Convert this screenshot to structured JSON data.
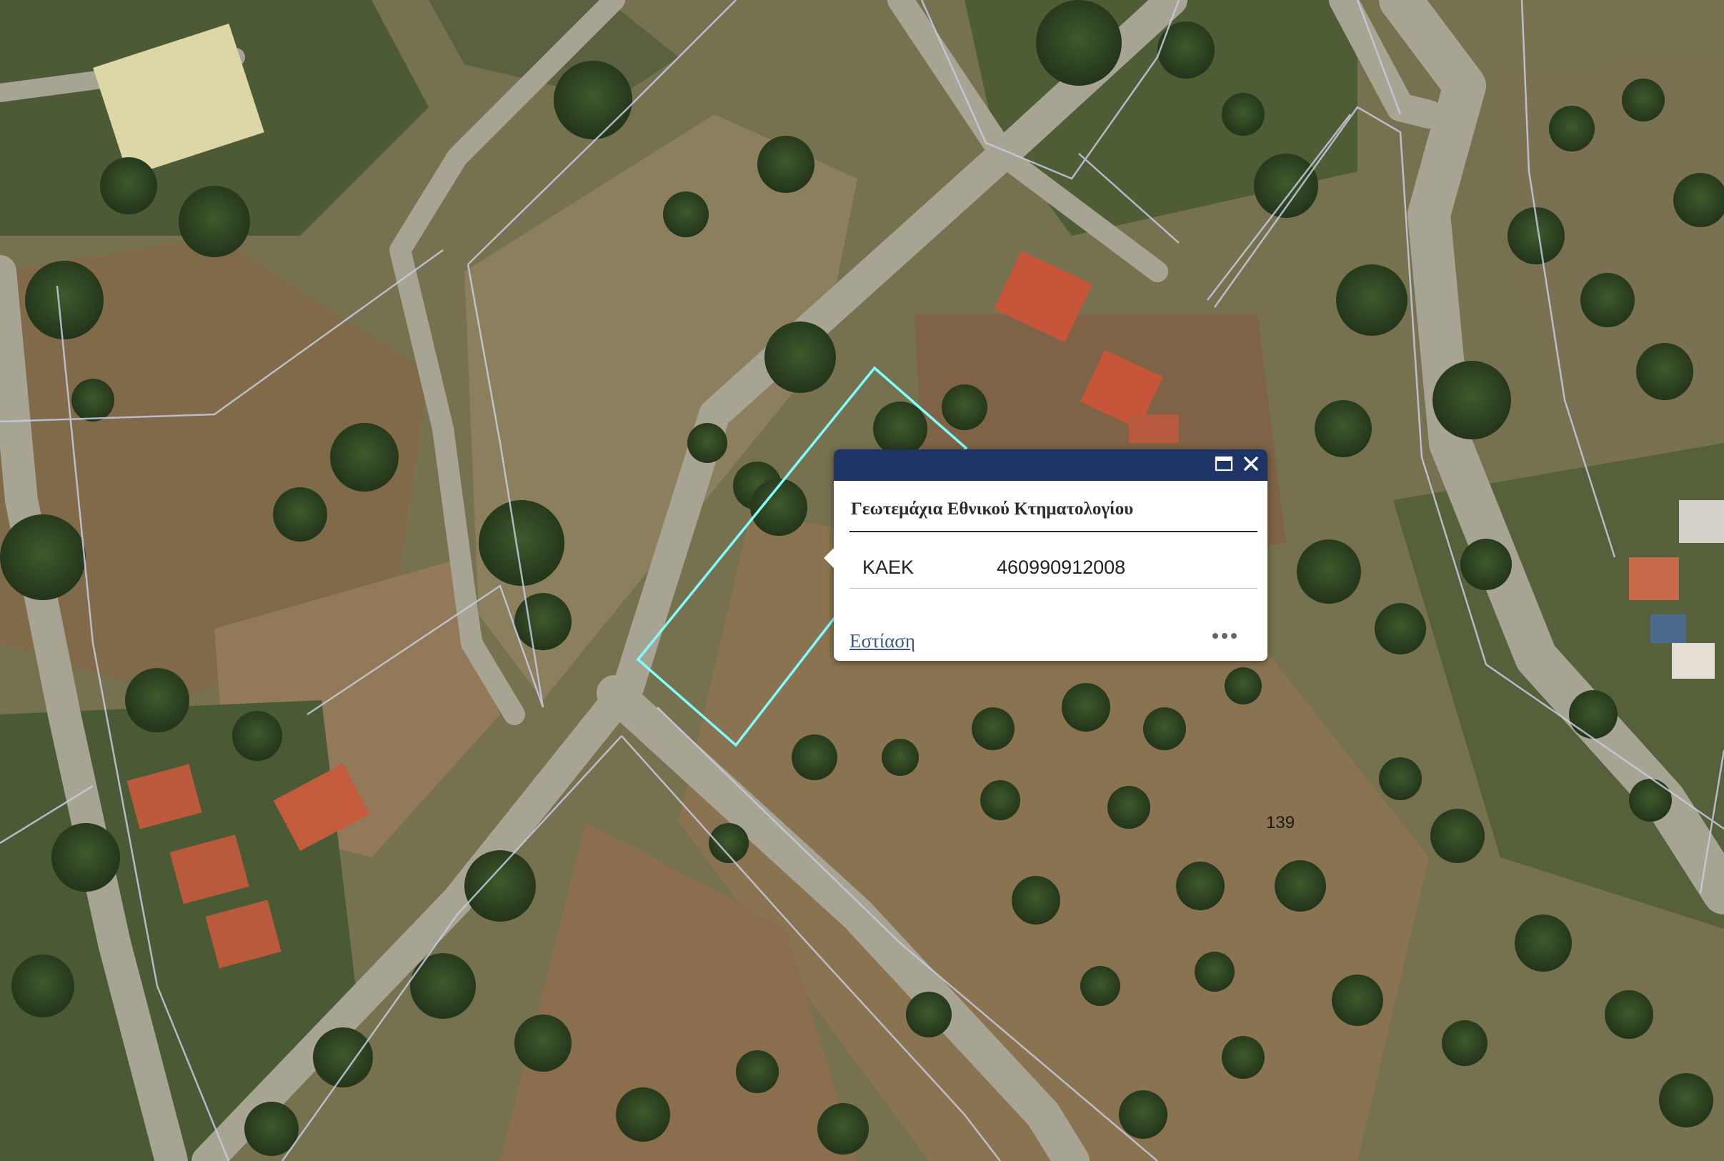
{
  "map": {
    "parcel_label": "139",
    "highlight_color": "#7fffff",
    "parcel_line_color": "#c7cbe0"
  },
  "popup": {
    "title": "Γεωτεμάχια Εθνικού Κτηματολογίου",
    "attributes": [
      {
        "name": "ΚΑΕΚ",
        "value": "460990912008"
      }
    ],
    "zoom_link": "Εστίαση",
    "header_color": "#1f3466",
    "icons": {
      "maximize": "maximize-icon",
      "close": "close-icon",
      "more": "more-icon"
    }
  }
}
